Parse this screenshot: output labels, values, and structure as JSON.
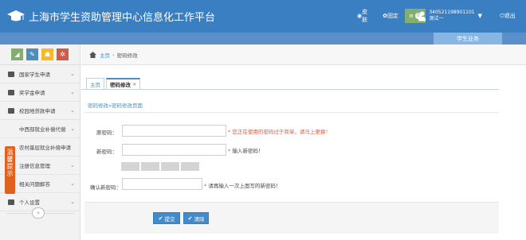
{
  "header": {
    "title": "上海市学生资助管理中心信息化工作平台",
    "buttons": [
      {
        "label": "皮肤",
        "color": "#3a7fc1"
      },
      {
        "label": "固定",
        "color": "#3a7fc1"
      },
      {
        "label": "0",
        "color": "#82af6f"
      }
    ],
    "user": {
      "id": "340521198901101",
      "name": "测试一"
    },
    "logout_label": "退出",
    "subtab_label": "学生业务"
  },
  "sidebar": {
    "shortcut_colors": [
      "#82af6f",
      "#4c8fbd",
      "#f8b82c",
      "#d15b47"
    ],
    "items": [
      {
        "label": "国家学生申请"
      },
      {
        "label": "奖学金申请"
      },
      {
        "label": "校园地贷款申请"
      },
      {
        "label": "中西部就业补偿代偿"
      },
      {
        "label": "农村基层就业补偿申请"
      },
      {
        "label": "注册信息管理"
      },
      {
        "label": "相关问题解答"
      },
      {
        "label": "个人设置"
      }
    ],
    "notice_label": "温馨提示"
  },
  "breadcrumb": {
    "home": "主页",
    "current": "密码修改"
  },
  "tabs": [
    {
      "label": "主页"
    },
    {
      "label": "密码修改"
    }
  ],
  "subcrumb": {
    "current": "密码修改",
    "rest": "»密码修改页面"
  },
  "form": {
    "old_label": "原密码：",
    "old_hint": "* 您正在使用的密码过于简单，请马上更换！",
    "new_label": "新密码：",
    "new_hint": "输入新密码！",
    "confirm_label": "确认新密码：",
    "confirm_hint": "请再输入一次上面写的新密码！",
    "submit_label": "提交",
    "reset_label": "清除"
  }
}
